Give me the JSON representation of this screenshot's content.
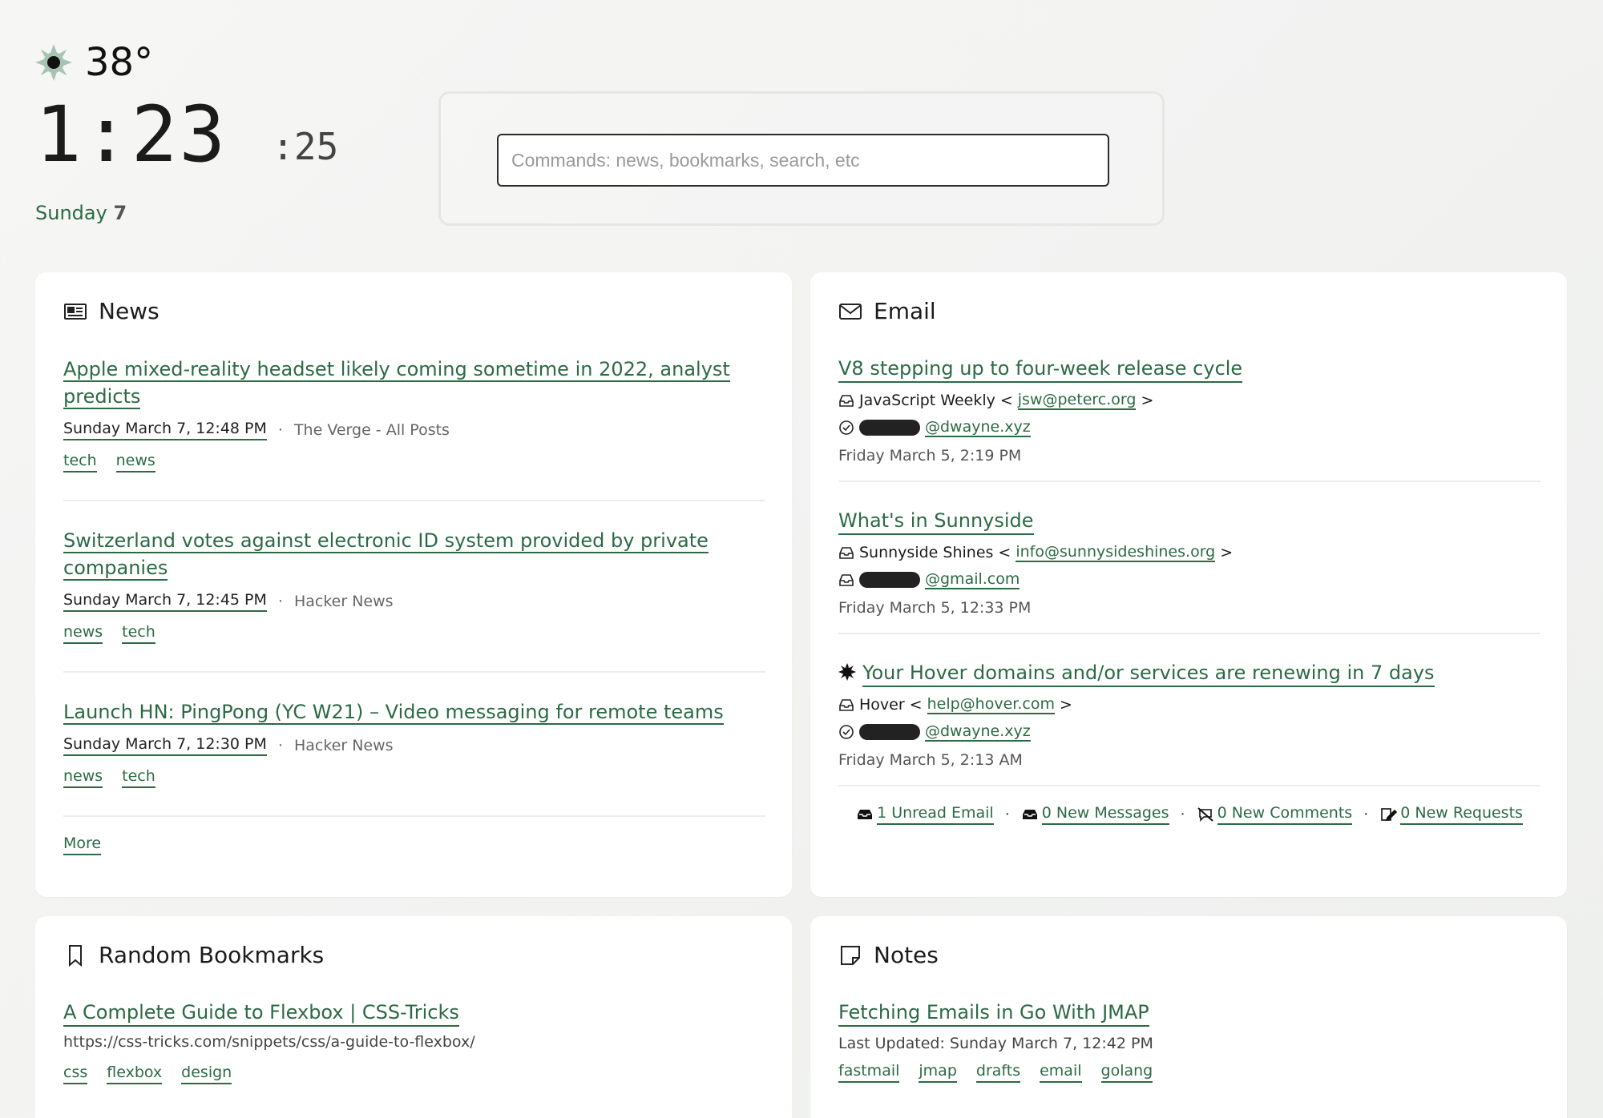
{
  "weather": {
    "icon": "sun-icon",
    "temperature": "38°"
  },
  "clock": {
    "time": "1:23",
    "seconds": ":25",
    "day_name": "Sunday",
    "day_number": "7"
  },
  "command": {
    "placeholder": "Commands: news, bookmarks, search, etc"
  },
  "news": {
    "title": "News",
    "items": [
      {
        "title": "Apple mixed-reality headset likely coming sometime in 2022, analyst predicts",
        "date": "Sunday March 7, 12:48 PM",
        "source": "The Verge - All Posts",
        "tags": [
          "tech",
          "news"
        ]
      },
      {
        "title": "Switzerland votes against electronic ID system provided by private companies",
        "date": "Sunday March 7, 12:45 PM",
        "source": "Hacker News",
        "tags": [
          "news",
          "tech"
        ]
      },
      {
        "title": "Launch HN: PingPong (YC W21) – Video messaging for remote teams",
        "date": "Sunday March 7, 12:30 PM",
        "source": "Hacker News",
        "tags": [
          "news",
          "tech"
        ]
      }
    ],
    "more_label": "More"
  },
  "email": {
    "title": "Email",
    "items": [
      {
        "subject": "V8 stepping up to four-week release cycle",
        "from_name": "JavaScript Weekly",
        "from_addr": "jsw@peterc.org",
        "to_addr": "@dwayne.xyz",
        "date": "Friday March 5, 2:19 PM"
      },
      {
        "subject": "What's in Sunnyside",
        "from_name": "Sunnyside Shines",
        "from_addr": "info@sunnysideshines.org",
        "to_addr": "@gmail.com",
        "date": "Friday March 5, 12:33 PM"
      },
      {
        "subject": "Your Hover domains and/or services are renewing in 7 days",
        "from_name": "Hover",
        "from_addr": "help@hover.com",
        "to_addr": "@dwayne.xyz",
        "date": "Friday March 5, 2:13 AM"
      }
    ],
    "summary": {
      "unread": "1 Unread Email",
      "messages": "0 New Messages",
      "comments": "0 New Comments",
      "requests": "0 New Requests"
    }
  },
  "bookmarks": {
    "title": "Random Bookmarks",
    "item": {
      "title": "A Complete Guide to Flexbox | CSS-Tricks",
      "url": "https://css-tricks.com/snippets/css/a-guide-to-flexbox/",
      "tags": [
        "css",
        "flexbox",
        "design"
      ]
    }
  },
  "notes": {
    "title": "Notes",
    "item": {
      "title": "Fetching Emails in Go With JMAP",
      "updated": "Last Updated: Sunday March 7, 12:42 PM",
      "tags": [
        "fastmail",
        "jmap",
        "drafts",
        "email",
        "golang"
      ]
    }
  },
  "colors": {
    "accent": "#2c6a44",
    "background": "#f4f4f3",
    "card": "#ffffff"
  }
}
